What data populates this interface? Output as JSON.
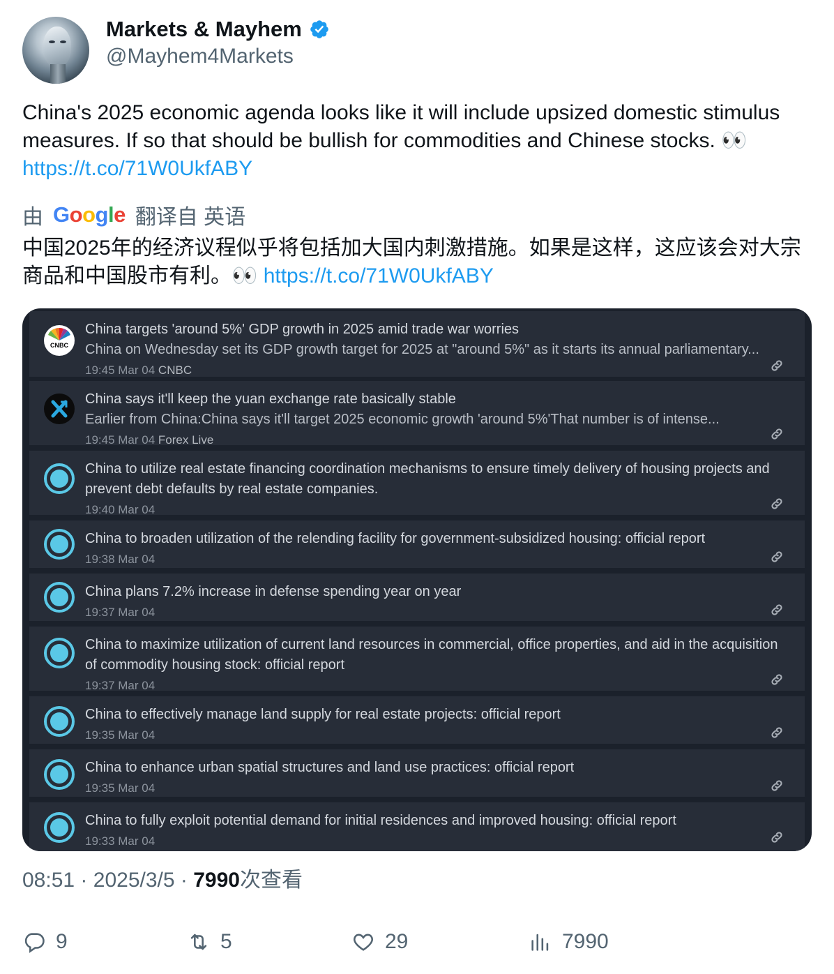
{
  "author": {
    "name": "Markets & Mayhem",
    "handle": "@Mayhem4Markets",
    "verified_icon": "verified-badge-icon"
  },
  "tweet": {
    "text": "China's 2025 economic agenda looks like it will include upsized domestic stimulus measures. If so that should be bullish for commodities and Chinese stocks. 👀",
    "link": "https://t.co/71W0UkfABY"
  },
  "translation": {
    "by_prefix": "由",
    "google_letters": [
      "G",
      "o",
      "o",
      "g",
      "l",
      "e"
    ],
    "suffix": "翻译自 英语",
    "text": "中国2025年的经济议程似乎将包括加大国内刺激措施。如果是这样，这应该会对大宗商品和中国股市有利。👀",
    "link": "https://t.co/71W0UkfABY"
  },
  "news_items": [
    {
      "icon": "cnbc",
      "title": "China targets 'around 5%' GDP growth in 2025 amid trade war worries",
      "subtitle": "China on Wednesday set its GDP growth target for 2025 at \"around 5%\" as it starts its annual parliamentary...",
      "time": "19:45 Mar 04",
      "source": "CNBC"
    },
    {
      "icon": "forex",
      "title": "China says it'll keep the yuan exchange rate basically stable",
      "subtitle": "Earlier from China:China says it'll target 2025 economic growth 'around 5%'That number is of intense...",
      "time": "19:45 Mar 04",
      "source": "Forex Live"
    },
    {
      "icon": "ring",
      "title": "China to utilize real estate financing coordination mechanisms to ensure timely delivery of housing projects and prevent debt defaults by real estate companies.",
      "subtitle": "",
      "time": "19:40 Mar 04",
      "source": ""
    },
    {
      "icon": "ring",
      "title": "China to broaden utilization of the relending facility for government-subsidized housing: official report",
      "subtitle": "",
      "time": "19:38 Mar 04",
      "source": ""
    },
    {
      "icon": "ring",
      "title": "China plans 7.2% increase in defense spending year on year",
      "subtitle": "",
      "time": "19:37 Mar 04",
      "source": ""
    },
    {
      "icon": "ring",
      "title": "China to maximize utilization of current land resources in commercial, office properties, and aid in the acquisition of commodity housing stock: official report",
      "subtitle": "",
      "time": "19:37 Mar 04",
      "source": ""
    },
    {
      "icon": "ring",
      "title": "China to effectively manage land supply for real estate projects: official report",
      "subtitle": "",
      "time": "19:35 Mar 04",
      "source": ""
    },
    {
      "icon": "ring",
      "title": "China to enhance urban spatial structures and land use practices: official report",
      "subtitle": "",
      "time": "19:35 Mar 04",
      "source": ""
    },
    {
      "icon": "ring",
      "title": "China to fully exploit potential demand for initial residences and improved housing: official report",
      "subtitle": "",
      "time": "19:33 Mar 04",
      "source": ""
    }
  ],
  "meta": {
    "time": "08:51",
    "date": "2025/3/5",
    "separator": "·",
    "views": "7990",
    "views_label": "次查看"
  },
  "actions": {
    "replies": "9",
    "retweets": "5",
    "likes": "29",
    "views": "7990"
  },
  "colors": {
    "link": "#1d9bf0",
    "card_bg": "#1b212b",
    "item_bg": "#272d38",
    "ring": "#5ac8e6",
    "verified": "#1d9bf0"
  }
}
